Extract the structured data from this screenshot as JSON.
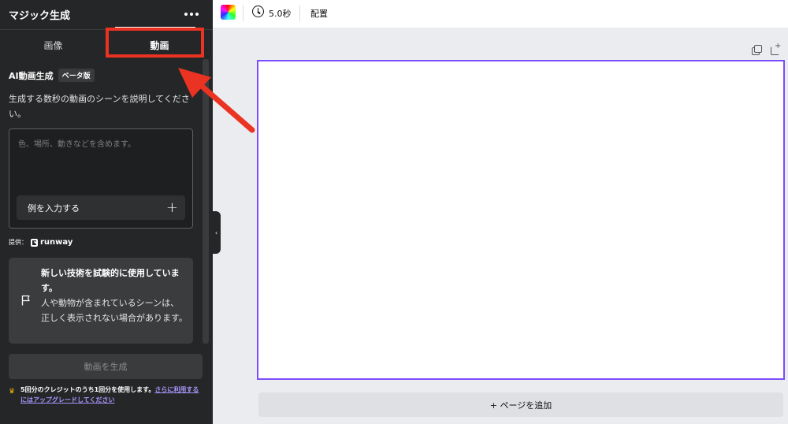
{
  "panel": {
    "title": "マジック生成",
    "tabs": [
      {
        "label": "画像",
        "active": false
      },
      {
        "label": "動画",
        "active": true
      }
    ],
    "section_title": "AI動画生成",
    "beta_badge": "ベータ版",
    "description": "生成する数秒の動画のシーンを説明してください。",
    "prompt_input": {
      "placeholder": "色、場所、動きなどを含めます。",
      "value": ""
    },
    "example_button": "例を入力する",
    "provider_label": "提供：",
    "provider_name": "runway",
    "notice": {
      "title": "新しい技術を試験的に使用しています。",
      "body": "人や動物が含まれているシーンは、正しく表示されない場合があります。"
    },
    "generate_button": "動画を生成",
    "credit": {
      "text": "5回分のクレジットのうち1回分を使用します。",
      "link": "さらに利用するにはアップグレードしてください"
    }
  },
  "toolbar": {
    "duration": "5.0秒",
    "arrange": "配置"
  },
  "canvas": {
    "add_page_button": "+ ページを追加"
  },
  "colors": {
    "panel_bg": "#252627",
    "accent": "#7c4dff",
    "annotation": "#ea3322",
    "link": "#a996ff"
  }
}
